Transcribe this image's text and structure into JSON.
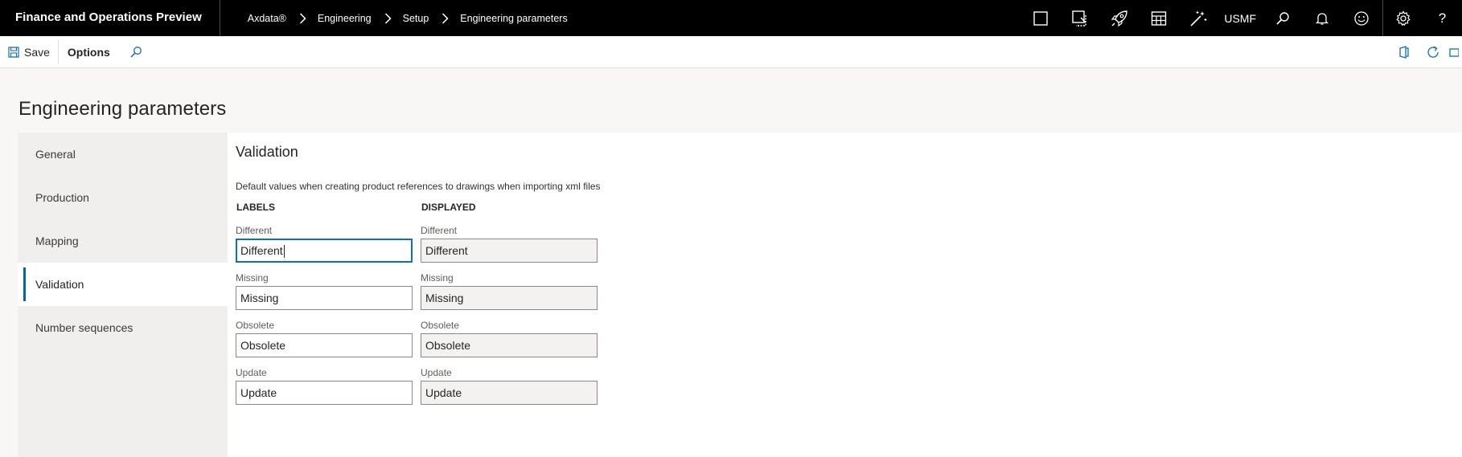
{
  "app": {
    "title": "Finance and Operations Preview"
  },
  "breadcrumb": [
    "Axdata®",
    "Engineering",
    "Setup",
    "Engineering parameters"
  ],
  "header": {
    "company": "USMF",
    "icons": [
      "window-icon",
      "picture-in-picture-icon",
      "rocket-icon",
      "grid-table-icon",
      "magic-wand-icon",
      "search-icon",
      "bell-icon",
      "smiley-icon",
      "gear-icon",
      "help-icon"
    ]
  },
  "actionbar": {
    "save_label": "Save",
    "options_label": "Options"
  },
  "page": {
    "title": "Engineering parameters"
  },
  "nav": {
    "items": [
      {
        "label": "General"
      },
      {
        "label": "Production"
      },
      {
        "label": "Mapping"
      },
      {
        "label": "Validation"
      },
      {
        "label": "Number sequences"
      }
    ],
    "active": "Validation"
  },
  "section": {
    "title": "Validation",
    "description": "Default values when creating product references to drawings when importing xml files",
    "columns": {
      "labels": "LABELS",
      "displayed": "DISPLAYED"
    },
    "rows": [
      {
        "label": "Different",
        "label_value": "Different",
        "displayed_label": "Different",
        "displayed_value": "Different"
      },
      {
        "label": "Missing",
        "label_value": "Missing",
        "displayed_label": "Missing",
        "displayed_value": "Missing"
      },
      {
        "label": "Obsolete",
        "label_value": "Obsolete",
        "displayed_label": "Obsolete",
        "displayed_value": "Obsolete"
      },
      {
        "label": "Update",
        "label_value": "Update",
        "displayed_label": "Update",
        "displayed_value": "Update"
      }
    ]
  },
  "colors": {
    "topbar": "#000000",
    "accent": "#106ebe",
    "active_indicator": "#006a9e",
    "readonly_field": "#f3f2f1"
  }
}
